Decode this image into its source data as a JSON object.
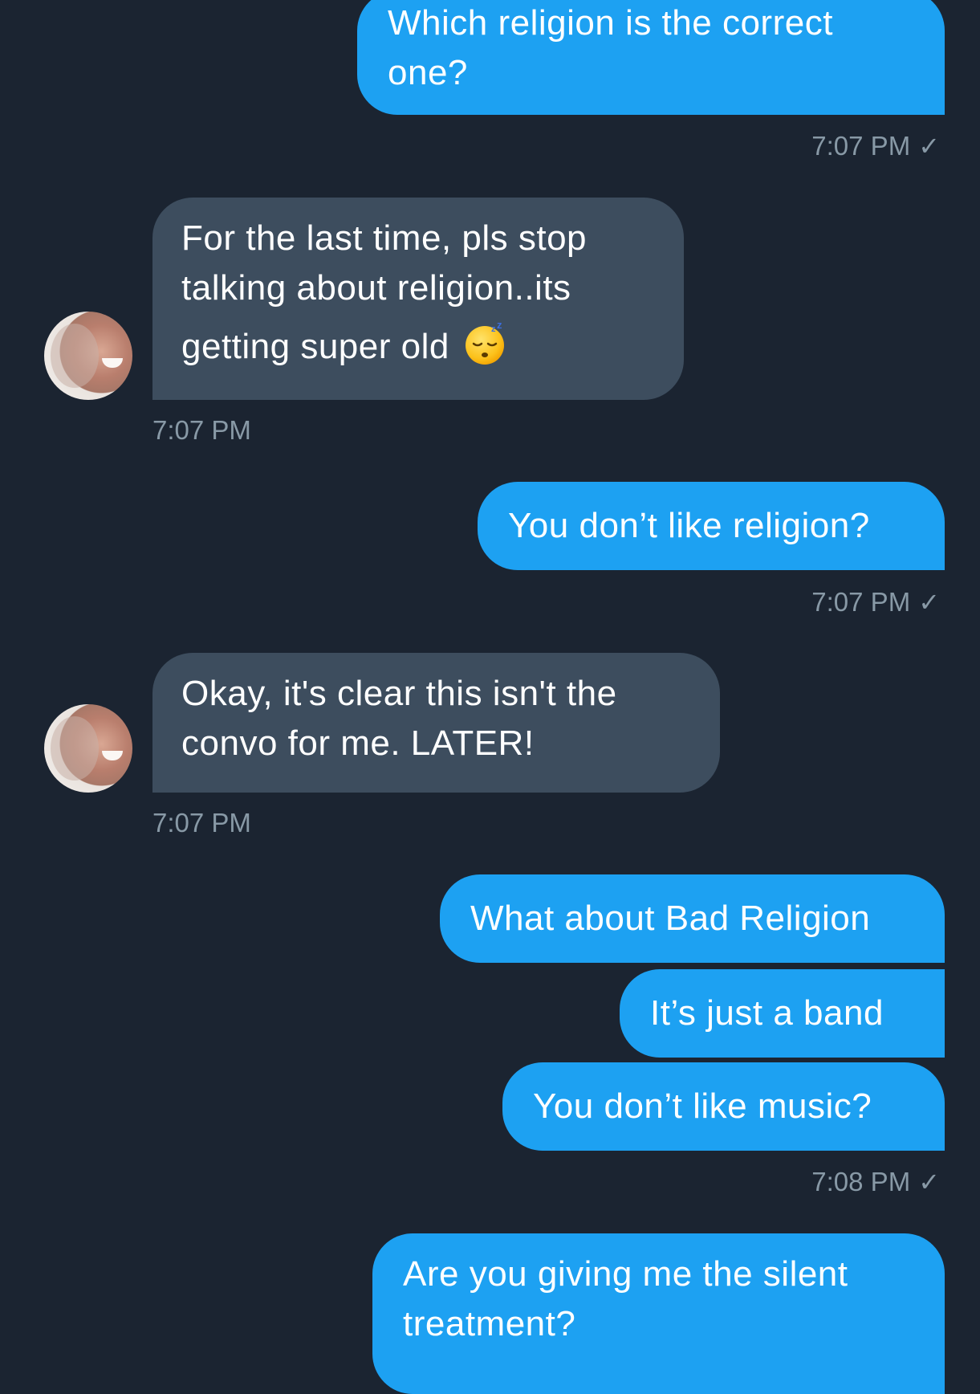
{
  "messages": [
    {
      "lines": [
        "Which religion is the correct",
        "one?"
      ]
    },
    {
      "lines": [
        "For the last time, pls stop",
        "talking about religion..its",
        "getting super old"
      ],
      "emoji": "sleeping-face-icon"
    },
    {
      "lines": [
        "You don’t like religion?"
      ]
    },
    {
      "lines": [
        "Okay, it's clear this isn't the",
        "convo for me. LATER!"
      ]
    },
    {
      "lines": [
        "What about Bad Religion"
      ]
    },
    {
      "lines": [
        "It’s just a band"
      ]
    },
    {
      "lines": [
        "You don’t like music?"
      ]
    },
    {
      "lines": [
        "Are you giving me the silent",
        "treatment?"
      ]
    }
  ],
  "timestamps": [
    "7:07 PM",
    "7:07 PM",
    "7:07 PM",
    "7:07 PM",
    "7:08 PM"
  ],
  "icons": {
    "read_check": "✓",
    "avatar": "avatar-photo",
    "emoji": "sleeping-face-icon"
  },
  "colors": {
    "background": "#1b2431",
    "sent_bubble": "#1da1f2",
    "received_bubble": "#3d4d5e",
    "timestamp": "#8899a6"
  }
}
